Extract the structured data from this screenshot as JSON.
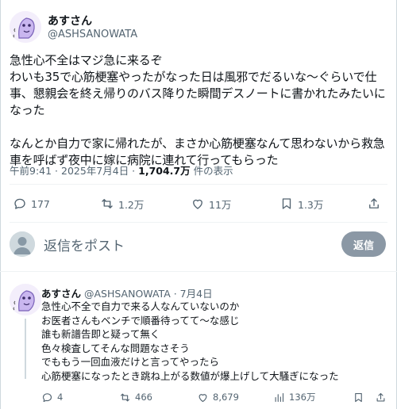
{
  "tweet": {
    "display_name": "あすさん",
    "handle": "@ASHSANOWATA",
    "text": "急性心不全はマジ急に来るぞ\nわいも35で心筋梗塞やったがなった日は風邪でだるいな〜ぐらいで仕事、懇親会を終え帰りのバス降りた瞬間デスノートに書かれたみたいになった\n\nなんとか自力で家に帰れたが、まさか心筋梗塞なんて思わないから救急車を呼ばず夜中に嫁に病院に連れて行ってもらった",
    "timestamp": "午前9:41 · 2025年7月4日 · ",
    "views": "1,704.7万",
    "views_label": " 件の表示",
    "actions": {
      "reply_count": "177",
      "retweet_count": "1.2万",
      "like_count": "11万",
      "bookmark_count": "1.3万"
    }
  },
  "reply_composer": {
    "placeholder": "返信をポスト",
    "button_label": "返信"
  },
  "reply": {
    "display_name": "あすさん",
    "handle": "@ASHSANOWATA",
    "date": " · 7月4日",
    "text": "急性心不全で自力で来る人なんていないのか\nお医者さんもベンチで順番待ってて〜な感じ\n誰も新譜告即と疑って無く\n色々検査してそんな問題なさそう\nでももう一回血液だけと言ってやったら\n心筋梗塞になったとき跳ね上がる数値が爆上げして大騒ぎになった",
    "actions": {
      "reply_count": "4",
      "retweet_count": "466",
      "like_count": "8,679",
      "views_count": "136万"
    }
  },
  "icons": [
    "avatar-ghost-icon",
    "reply-icon",
    "retweet-icon",
    "like-icon",
    "bookmark-icon",
    "share-icon",
    "views-icon",
    "default-avatar-icon"
  ],
  "colors": {
    "text": "#0f1419",
    "secondary": "#536471",
    "border": "#eff3f4",
    "reply_button": "#8b98a5"
  }
}
